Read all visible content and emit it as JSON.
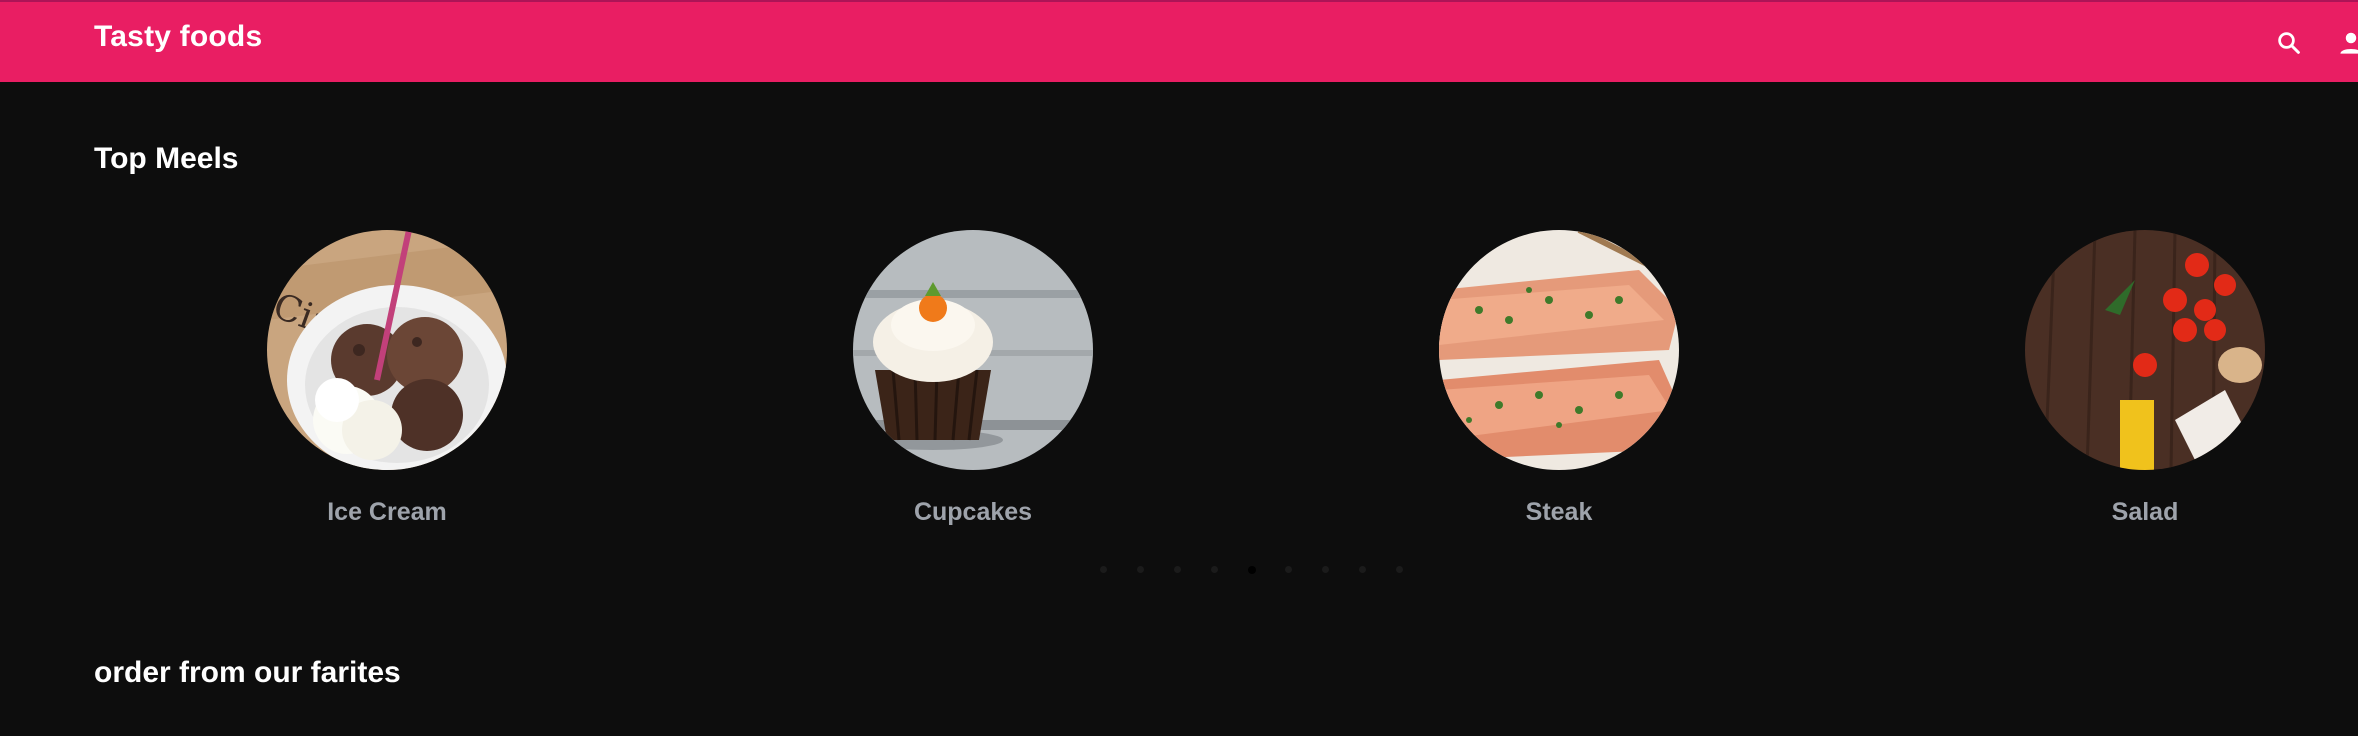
{
  "header": {
    "brand": "Tasty foods",
    "color": "#e91e63",
    "icons": [
      "search-icon",
      "account-icon"
    ]
  },
  "sections": {
    "top_meals_title": "Top Meels",
    "favorites_title": "order from our farites"
  },
  "meals": [
    {
      "label": "Ice Cream"
    },
    {
      "label": "Cupcakes"
    },
    {
      "label": "Steak"
    },
    {
      "label": "Salad"
    }
  ],
  "carousel": {
    "dot_count": 9,
    "active_index": 4
  }
}
